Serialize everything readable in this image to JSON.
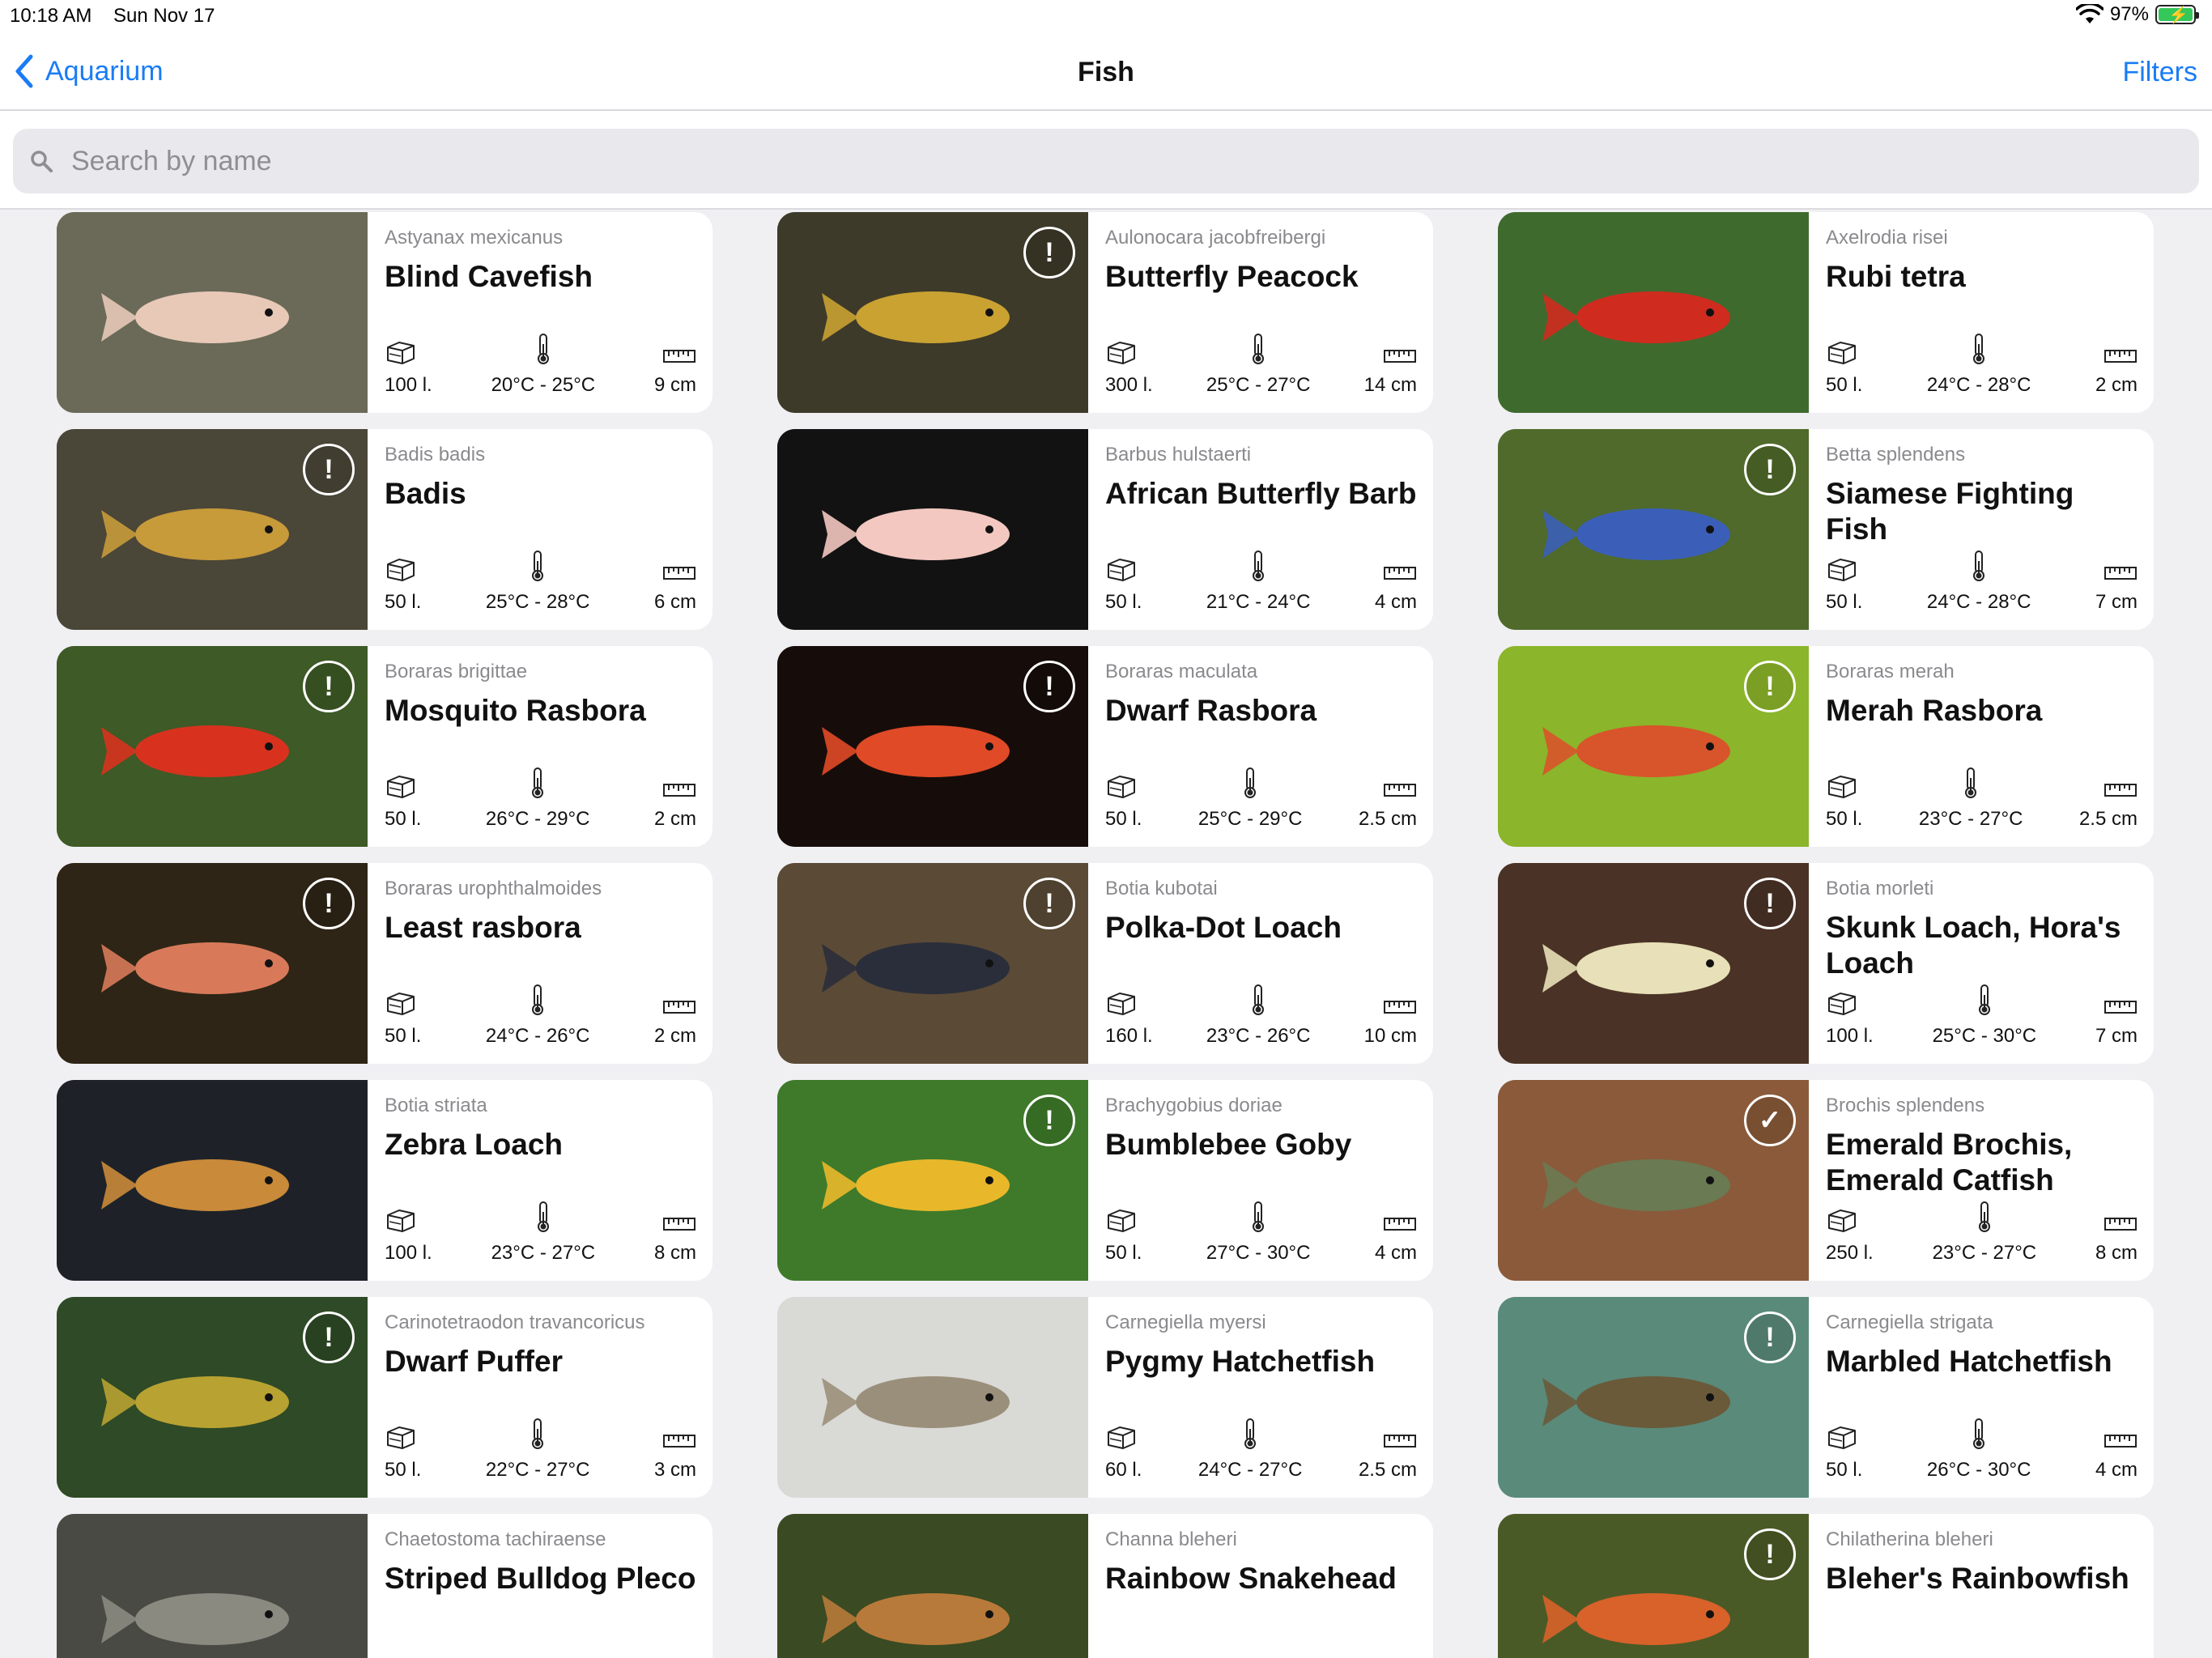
{
  "status_bar": {
    "time": "10:18 AM",
    "date": "Sun Nov 17",
    "battery": "97%"
  },
  "nav": {
    "back_label": "Aquarium",
    "title": "Fish",
    "filters_label": "Filters"
  },
  "search": {
    "placeholder": "Search by name",
    "value": ""
  },
  "icons": {
    "volume": "tank-icon",
    "temperature": "thermometer-icon",
    "size": "ruler-icon",
    "warning": "exclamation-circle-icon",
    "compatible": "checkmark-circle-icon"
  },
  "fish": [
    {
      "scientific": "Astyanax mexicanus",
      "common": "Blind Cavefish",
      "volume": "100 l.",
      "temp": "20°C - 25°C",
      "size": "9 cm",
      "badge": "",
      "bg": "#6b6a58",
      "fish_color": "#e8c9b8"
    },
    {
      "scientific": "Aulonocara jacobfreibergi",
      "common": "Butterfly Peacock",
      "volume": "300 l.",
      "temp": "25°C - 27°C",
      "size": "14 cm",
      "badge": "!",
      "bg": "#3d3a2a",
      "fish_color": "#c9a232"
    },
    {
      "scientific": "Axelrodia risei",
      "common": "Rubi tetra",
      "volume": "50 l.",
      "temp": "24°C - 28°C",
      "size": "2 cm",
      "badge": "",
      "bg": "#3f6a2e",
      "fish_color": "#d02b1f"
    },
    {
      "scientific": "Badis badis",
      "common": "Badis",
      "volume": "50 l.",
      "temp": "25°C - 28°C",
      "size": "6 cm",
      "badge": "!",
      "bg": "#4a4638",
      "fish_color": "#c79a3a"
    },
    {
      "scientific": "Barbus hulstaerti",
      "common": "African Butterfly Barb",
      "volume": "50 l.",
      "temp": "21°C - 24°C",
      "size": "4 cm",
      "badge": "",
      "bg": "#121212",
      "fish_color": "#f2c8c0"
    },
    {
      "scientific": "Betta splendens",
      "common": "Siamese Fighting Fish",
      "volume": "50 l.",
      "temp": "24°C - 28°C",
      "size": "7 cm",
      "badge": "!",
      "bg": "#4f6a2a",
      "fish_color": "#3b5fb8"
    },
    {
      "scientific": "Boraras brigittae",
      "common": "Mosquito Rasbora",
      "volume": "50 l.",
      "temp": "26°C - 29°C",
      "size": "2 cm",
      "badge": "!",
      "bg": "#3e5a26",
      "fish_color": "#d8321f"
    },
    {
      "scientific": "Boraras maculata",
      "common": "Dwarf Rasbora",
      "volume": "50 l.",
      "temp": "25°C - 29°C",
      "size": "2.5 cm",
      "badge": "!",
      "bg": "#160d0a",
      "fish_color": "#e04a26"
    },
    {
      "scientific": "Boraras merah",
      "common": "Merah Rasbora",
      "volume": "50 l.",
      "temp": "23°C - 27°C",
      "size": "2.5 cm",
      "badge": "!",
      "bg": "#8bb52a",
      "fish_color": "#d8542a"
    },
    {
      "scientific": "Boraras urophthalmoides",
      "common": "Least rasbora",
      "volume": "50 l.",
      "temp": "24°C - 26°C",
      "size": "2 cm",
      "badge": "!",
      "bg": "#2e2516",
      "fish_color": "#d87a5a"
    },
    {
      "scientific": "Botia kubotai",
      "common": "Polka-Dot Loach",
      "volume": "160 l.",
      "temp": "23°C - 26°C",
      "size": "10 cm",
      "badge": "!",
      "bg": "#5a4a36",
      "fish_color": "#2a2e3a"
    },
    {
      "scientific": "Botia morleti",
      "common": "Skunk Loach, Hora's Loach",
      "volume": "100 l.",
      "temp": "25°C - 30°C",
      "size": "7 cm",
      "badge": "!",
      "bg": "#4a3326",
      "fish_color": "#e8e0b8"
    },
    {
      "scientific": "Botia striata",
      "common": "Zebra Loach",
      "volume": "100 l.",
      "temp": "23°C - 27°C",
      "size": "8 cm",
      "badge": "",
      "bg": "#1e2228",
      "fish_color": "#c98a3a"
    },
    {
      "scientific": "Brachygobius doriae",
      "common": "Bumblebee Goby",
      "volume": "50 l.",
      "temp": "27°C - 30°C",
      "size": "4 cm",
      "badge": "!",
      "bg": "#3e7a2a",
      "fish_color": "#e8b82a"
    },
    {
      "scientific": "Brochis splendens",
      "common": "Emerald Brochis, Emerald Catfish",
      "volume": "250 l.",
      "temp": "23°C - 27°C",
      "size": "8 cm",
      "badge": "✓",
      "bg": "#8a5a3a",
      "fish_color": "#6a7a52"
    },
    {
      "scientific": "Carinotetraodon travancoricus",
      "common": "Dwarf Puffer",
      "volume": "50 l.",
      "temp": "22°C - 27°C",
      "size": "3 cm",
      "badge": "!",
      "bg": "#2e4a26",
      "fish_color": "#b8a232"
    },
    {
      "scientific": "Carnegiella myersi",
      "common": "Pygmy Hatchetfish",
      "volume": "60 l.",
      "temp": "24°C - 27°C",
      "size": "2.5 cm",
      "badge": "",
      "bg": "#d9d9d6",
      "fish_color": "#9a8f7a"
    },
    {
      "scientific": "Carnegiella strigata",
      "common": "Marbled Hatchetfish",
      "volume": "50 l.",
      "temp": "26°C - 30°C",
      "size": "4 cm",
      "badge": "!",
      "bg": "#5a8a7a",
      "fish_color": "#6a5a3a"
    },
    {
      "scientific": "Chaetostoma tachiraense",
      "common": "Striped Bulldog Pleco",
      "volume": "",
      "temp": "",
      "size": "",
      "badge": "",
      "bg": "#4a4a44",
      "fish_color": "#8a8a80"
    },
    {
      "scientific": "Channa bleheri",
      "common": "Rainbow Snakehead",
      "volume": "",
      "temp": "",
      "size": "",
      "badge": "",
      "bg": "#3a4a22",
      "fish_color": "#b87a3a"
    },
    {
      "scientific": "Chilatherina bleheri",
      "common": "Bleher's Rainbowfish",
      "volume": "",
      "temp": "",
      "size": "",
      "badge": "!",
      "bg": "#4a5a26",
      "fish_color": "#d8622a"
    }
  ]
}
